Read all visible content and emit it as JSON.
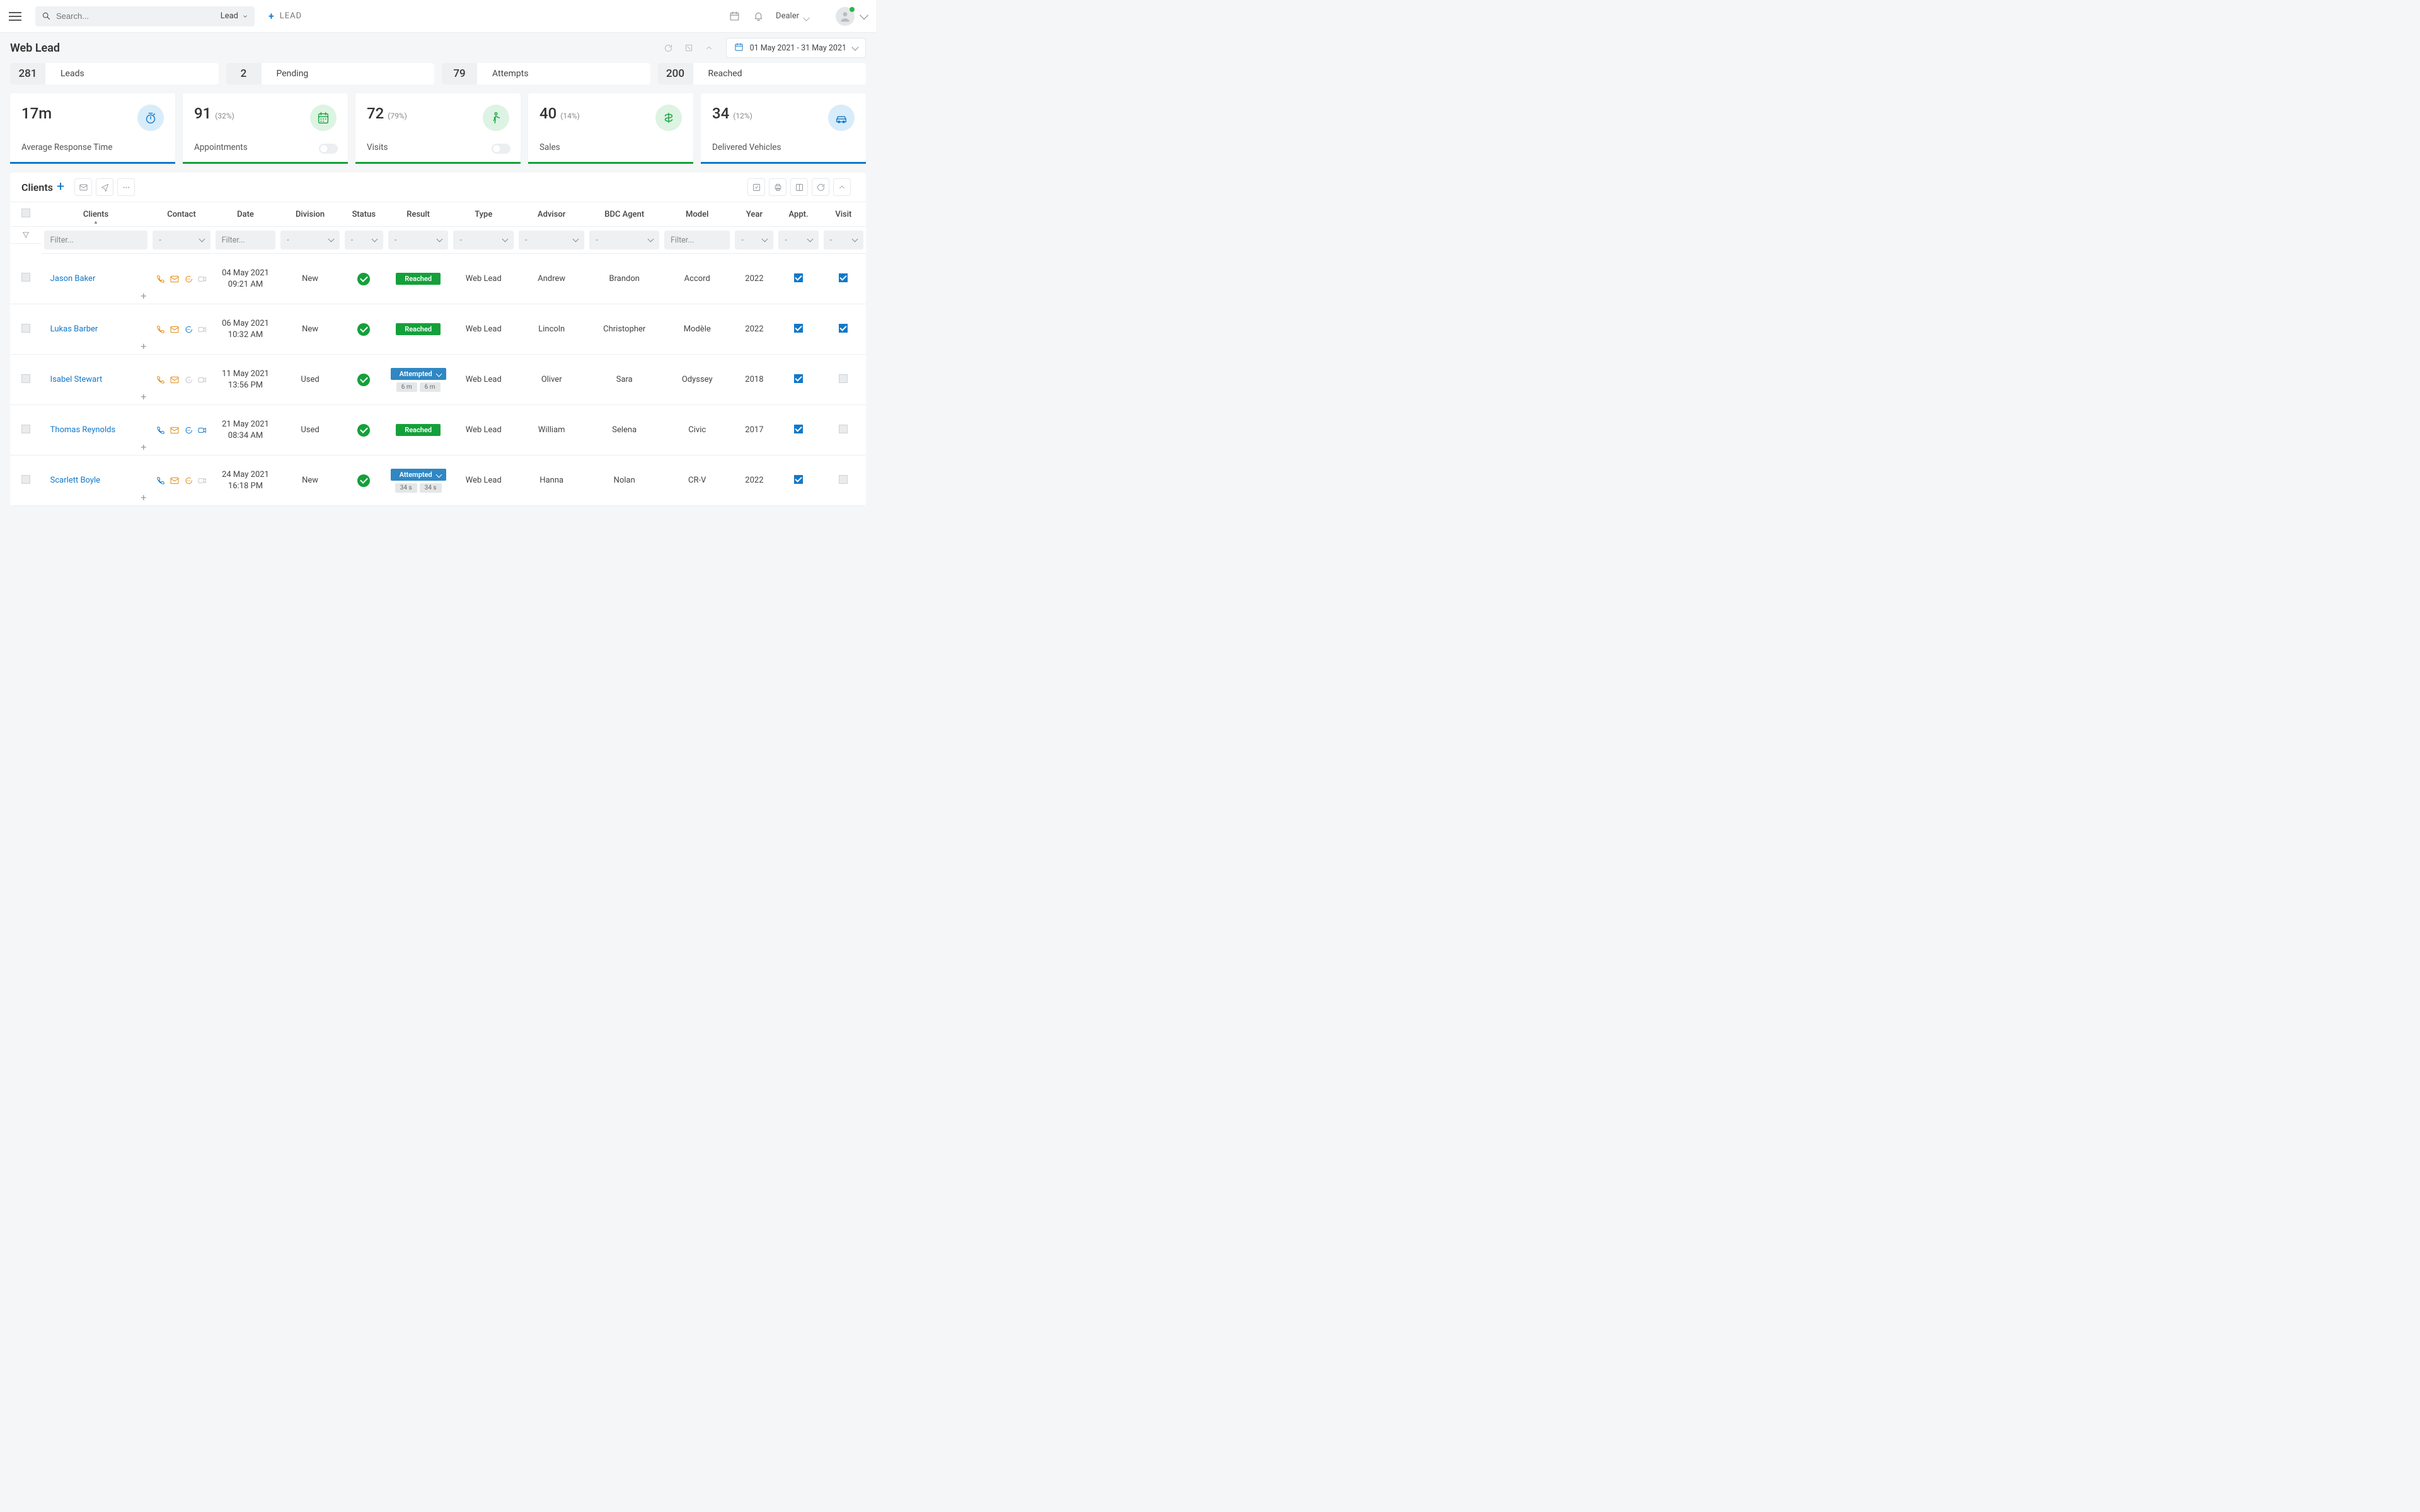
{
  "header": {
    "search_placeholder": "Search...",
    "search_type": "Lead",
    "add_lead_label": "LEAD",
    "user_label": "Dealer"
  },
  "page": {
    "title": "Web Lead",
    "date_range": "01 May 2021 - 31 May 2021"
  },
  "metrics": [
    {
      "value": "281",
      "label": "Leads"
    },
    {
      "value": "2",
      "label": "Pending"
    },
    {
      "value": "79",
      "label": "Attempts"
    },
    {
      "value": "200",
      "label": "Reached"
    }
  ],
  "stats": [
    {
      "value": "17m",
      "pct": "",
      "label": "Average Response Time",
      "icon": "stopwatch",
      "bar": "blue",
      "toggle": false
    },
    {
      "value": "91",
      "pct": "(32%)",
      "label": "Appointments",
      "icon": "calendar",
      "bar": "green",
      "toggle": true
    },
    {
      "value": "72",
      "pct": "(79%)",
      "label": "Visits",
      "icon": "walk",
      "bar": "green",
      "toggle": true
    },
    {
      "value": "40",
      "pct": "(14%)",
      "label": "Sales",
      "icon": "money",
      "bar": "green",
      "toggle": false
    },
    {
      "value": "34",
      "pct": "(12%)",
      "label": "Delivered Vehicles",
      "icon": "car",
      "bar": "blue",
      "toggle": false
    }
  ],
  "table": {
    "title": "Clients",
    "columns": [
      "",
      "Clients",
      "Contact",
      "Date",
      "Division",
      "Status",
      "Result",
      "Type",
      "Advisor",
      "BDC Agent",
      "Model",
      "Year",
      "Appt.",
      "Visit"
    ],
    "filters": {
      "clients": "Filter...",
      "date": "Filter...",
      "model": "Filter...",
      "dash": "-"
    },
    "rows": [
      {
        "client": "Jason Baker",
        "contact": {
          "phone": "orange",
          "mail": "orange",
          "chat": "orange",
          "video": "grey"
        },
        "date": "04 May 2021",
        "time": "09:21 AM",
        "division": "New",
        "status": "ok",
        "result": {
          "kind": "reached",
          "label": "Reached"
        },
        "type": "Web Lead",
        "advisor": "Andrew",
        "bdc": "Brandon",
        "model": "Accord",
        "year": "2022",
        "appt": true,
        "visit": true
      },
      {
        "client": "Lukas Barber",
        "contact": {
          "phone": "orange",
          "mail": "orange",
          "chat": "blue",
          "video": "grey"
        },
        "date": "06 May 2021",
        "time": "10:32 AM",
        "division": "New",
        "status": "ok",
        "result": {
          "kind": "reached",
          "label": "Reached"
        },
        "type": "Web Lead",
        "advisor": "Lincoln",
        "bdc": "Christopher",
        "model": "Modèle",
        "year": "2022",
        "appt": true,
        "visit": true
      },
      {
        "client": "Isabel Stewart",
        "contact": {
          "phone": "orange",
          "mail": "orange",
          "chat": "grey",
          "video": "grey"
        },
        "date": "11 May 2021",
        "time": "13:56 PM",
        "division": "Used",
        "status": "ok",
        "result": {
          "kind": "attempted",
          "label": "Attempted",
          "times": [
            "6 m",
            "6 m"
          ]
        },
        "type": "Web Lead",
        "advisor": "Oliver",
        "bdc": "Sara",
        "model": "Odyssey",
        "year": "2018",
        "appt": true,
        "visit": false
      },
      {
        "client": "Thomas Reynolds",
        "contact": {
          "phone": "blue",
          "mail": "orange",
          "chat": "blue",
          "video": "blue"
        },
        "date": "21 May 2021",
        "time": "08:34 AM",
        "division": "Used",
        "status": "ok",
        "result": {
          "kind": "reached",
          "label": "Reached"
        },
        "type": "Web Lead",
        "advisor": "William",
        "bdc": "Selena",
        "model": "Civic",
        "year": "2017",
        "appt": true,
        "visit": false
      },
      {
        "client": "Scarlett Boyle",
        "contact": {
          "phone": "blue",
          "mail": "orange",
          "chat": "orange",
          "video": "grey"
        },
        "date": "24 May 2021",
        "time": "16:18 PM",
        "division": "New",
        "status": "ok",
        "result": {
          "kind": "attempted",
          "label": "Attempted",
          "times": [
            "34 s",
            "34 s"
          ]
        },
        "type": "Web Lead",
        "advisor": "Hanna",
        "bdc": "Nolan",
        "model": "CR-V",
        "year": "2022",
        "appt": true,
        "visit": false
      }
    ]
  }
}
